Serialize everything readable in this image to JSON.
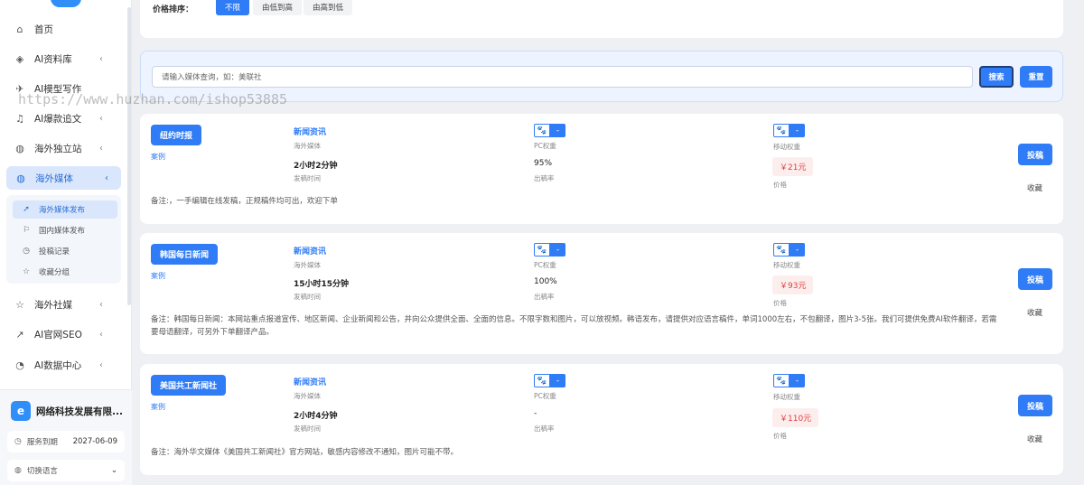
{
  "sidebar": {
    "nav": [
      {
        "label": "首页",
        "icon": "home-icon",
        "glyph": "⌂"
      },
      {
        "label": "AI资料库",
        "icon": "layers-icon",
        "glyph": "◈"
      },
      {
        "label": "AI模型写作",
        "icon": "rocket-icon",
        "glyph": "✈"
      },
      {
        "label": "AI爆款追文",
        "icon": "bell-icon",
        "glyph": "♫"
      },
      {
        "label": "海外独立站",
        "icon": "globe-icon",
        "glyph": "◍"
      },
      {
        "label": "海外媒体",
        "icon": "globe-icon",
        "glyph": "◍"
      },
      {
        "label": "海外社媒",
        "icon": "star-icon",
        "glyph": "☆"
      },
      {
        "label": "AI官网SEO",
        "icon": "chart-icon",
        "glyph": "↗"
      },
      {
        "label": "AI数据中心",
        "icon": "pie-icon",
        "glyph": "◔"
      }
    ],
    "submenu": [
      {
        "label": "海外媒体发布",
        "icon": "send-icon",
        "glyph": "➚"
      },
      {
        "label": "国内媒体发布",
        "icon": "flag-icon",
        "glyph": "⚐"
      },
      {
        "label": "投稿记录",
        "icon": "clock-icon",
        "glyph": "◷"
      },
      {
        "label": "收藏分组",
        "icon": "star-icon",
        "glyph": "☆"
      }
    ],
    "company": {
      "name": "网络科技发展有限...",
      "logo_letter": "e",
      "service_label": "服务到期",
      "service_date": "2027-06-09",
      "language_label": "切换语言"
    }
  },
  "filter": {
    "label": "价格排序：",
    "options": [
      "不限",
      "由低到高",
      "由高到低"
    ],
    "selected": "不限"
  },
  "search": {
    "placeholder": "请输入媒体查询，如：美联社",
    "search_label": "搜索",
    "reset_label": "重置"
  },
  "labels": {
    "case": "案例",
    "media_type": "海外媒体",
    "publish_time": "发稿时间",
    "pc_weight": "PC权重",
    "rate": "出稿率",
    "mobile_weight": "移动权重",
    "price": "价格",
    "post": "投稿",
    "favorite": "收藏"
  },
  "media": [
    {
      "name": "纽约时报",
      "category": "新闻资讯",
      "time": "2小时2分钟",
      "pc_weight": "-",
      "rate": "95%",
      "mobile_weight": "-",
      "price": "￥21元",
      "note": "备注:，一手编辑在线发稿，正规稿件均可出，欢迎下单"
    },
    {
      "name": "韩国每日新闻",
      "category": "新闻资讯",
      "time": "15小时15分钟",
      "pc_weight": "-",
      "rate": "100%",
      "mobile_weight": "-",
      "price": "￥93元",
      "note": "备注：韩国每日新闻：本网站重点报道宣传、地区新闻、企业新闻和公告，并向公众提供全面、全面的信息。不限字数和图片，可以放视频。韩语发布，请提供对应语言稿件，单词1000左右，不包翻译，图片3-5张。我们可提供免费AI软件翻译，若需要母语翻译，可另外下单翻译产品。"
    },
    {
      "name": "美国共工新闻社",
      "category": "新闻资讯",
      "time": "2小时4分钟",
      "pc_weight": "-",
      "rate": "-",
      "mobile_weight": "-",
      "price": "￥110元",
      "note": "备注：海外华文媒体《美国共工新闻社》官方网站，敏感内容修改不通知，图片可能不带。"
    }
  ],
  "watermark": "https://www.huzhan.com/ishop53885",
  "colors": {
    "accent": "#2f7cf6",
    "price_red": "#e23c3c",
    "active_bg": "#d9e6fb"
  }
}
